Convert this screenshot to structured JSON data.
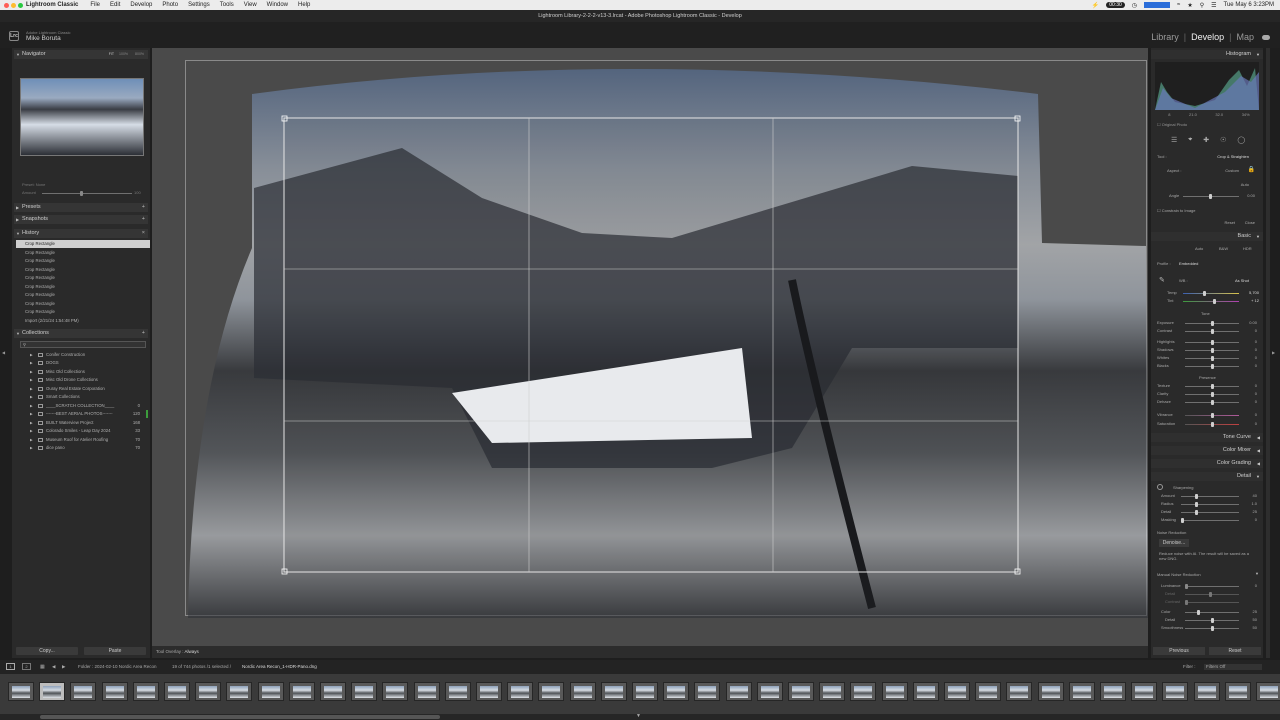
{
  "menubar": {
    "apple": "",
    "app": "Lightroom Classic",
    "items": [
      "File",
      "Edit",
      "Develop",
      "Photo",
      "Settings",
      "Tools",
      "View",
      "Window",
      "Help"
    ],
    "timer": "00:30",
    "clock": "Tue May 6  3:23PM"
  },
  "window": {
    "title": "Lightroom Library-2-2-2-v13-3.lrcat - Adobe Photoshop Lightroom Classic - Develop"
  },
  "identity": {
    "line1": "Adobe Lightroom Classic",
    "name": "Mike Boruta",
    "logo": "Lrc"
  },
  "modules": [
    "Library",
    "Develop",
    "Map"
  ],
  "modules_sep": "|",
  "active_module": "Develop",
  "left": {
    "navigator": {
      "title": "Navigator",
      "zoom": [
        "FIT",
        "100%",
        "800%"
      ]
    },
    "preset_amount": {
      "label": "Preset: None",
      "amount": "Amount",
      "value": "100"
    },
    "presets": "Presets",
    "snapshots": "Snapshots",
    "history": {
      "title": "History",
      "items": [
        "Crop Rectangle",
        "Crop Rectangle",
        "Crop Rectangle",
        "Crop Rectangle",
        "Crop Rectangle",
        "Crop Rectangle",
        "Crop Rectangle",
        "Crop Rectangle",
        "Crop Rectangle",
        "Import (2/21/24 1:54:48 PM)"
      ]
    },
    "collections": {
      "title": "Collections",
      "items": [
        {
          "name": "Conifer Construction",
          "count": ""
        },
        {
          "name": "DOGS",
          "count": ""
        },
        {
          "name": "Misc Old Collections",
          "count": ""
        },
        {
          "name": "Misc Old Drone Collections",
          "count": ""
        },
        {
          "name": "Ouray Real Estate Corporation",
          "count": ""
        },
        {
          "name": "Smart Collections",
          "count": ""
        },
        {
          "name": "____SCRATCH COLLECTION____",
          "count": "0"
        },
        {
          "name": "-------BEST AERIAL PHOTOS-------",
          "count": "120"
        },
        {
          "name": "BUILT Waterview Project",
          "count": "168"
        },
        {
          "name": "Colorado Smiles - Leap Day 2024",
          "count": "33"
        },
        {
          "name": "Museum Roof for Atelier Roofing",
          "count": "70"
        },
        {
          "name": "dice pano",
          "count": "70"
        }
      ]
    },
    "copy": "Copy...",
    "paste": "Paste"
  },
  "toolbar": {
    "overlay_label": "Tool Overlay :",
    "overlay_value": "Always"
  },
  "right": {
    "histogram": {
      "title": "Histogram",
      "readout": [
        "8",
        "21.0",
        "32.0",
        "34%"
      ],
      "original_photo": "Original Photo"
    },
    "crop": {
      "tool": "Tool :",
      "tool_name": "Crop & Straighten",
      "aspect": "Aspect :",
      "aspect_value": "Custom",
      "auto": "Auto",
      "angle": "Angle",
      "angle_value": "0.00",
      "constrain": "Constrain to Image",
      "reset": "Reset",
      "close": "Close"
    },
    "basic": {
      "title": "Basic",
      "modes": [
        "Auto",
        "B&W",
        "HDR"
      ],
      "profile_label": "Profile :",
      "profile": "Embedded",
      "wb_label": "WB :",
      "wb": "As Shot",
      "temp": {
        "label": "Temp",
        "value": "5,700"
      },
      "tint": {
        "label": "Tint",
        "value": "+ 12"
      },
      "tone": "Tone",
      "tone_sliders": [
        {
          "label": "Exposure",
          "value": "0.00"
        },
        {
          "label": "Contrast",
          "value": "0"
        },
        {
          "label": "Highlights",
          "value": "0"
        },
        {
          "label": "Shadows",
          "value": "0"
        },
        {
          "label": "Whites",
          "value": "0"
        },
        {
          "label": "Blacks",
          "value": "0"
        }
      ],
      "presence": "Presence",
      "presence_sliders": [
        {
          "label": "Texture",
          "value": "0"
        },
        {
          "label": "Clarity",
          "value": "0"
        },
        {
          "label": "Dehaze",
          "value": "0"
        },
        {
          "label": "Vibrance",
          "value": "0"
        },
        {
          "label": "Saturation",
          "value": "0"
        }
      ]
    },
    "tone_curve": "Tone Curve",
    "color_mixer": "Color Mixer",
    "color_grading": "Color Grading",
    "detail": {
      "title": "Detail",
      "sharpening": "Sharpening",
      "sliders": [
        {
          "label": "Amount",
          "value": "40"
        },
        {
          "label": "Radius",
          "value": "1.0"
        },
        {
          "label": "Detail",
          "value": "25"
        },
        {
          "label": "Masking",
          "value": "0"
        }
      ],
      "noise_reduction": "Noise Reduction",
      "denoise": "Denoise...",
      "denoise_note": "Reduce noise with AI. The result will be saved as a new DNG.",
      "manual_nr": "Manual Noise Reduction",
      "nr_sliders": [
        {
          "label": "Luminance",
          "value": "0"
        },
        {
          "label": "Detail",
          "value": ""
        },
        {
          "label": "Contrast",
          "value": ""
        },
        {
          "label": "Color",
          "value": "25"
        },
        {
          "label": "Detail",
          "value": "50"
        },
        {
          "label": "Smoothness",
          "value": "50"
        }
      ]
    },
    "previous": "Previous",
    "reset": "Reset"
  },
  "filmbar": {
    "pages": [
      "1",
      "2"
    ],
    "folder": "Folder : 2024-02-10 Nordic Area Recon",
    "count": "19 of 744 photos /1 selected /",
    "filename": "Nordic Area Recon_1-HDR-Pano.dng",
    "filter_label": "Filter :",
    "filter_value": "Filters Off"
  }
}
